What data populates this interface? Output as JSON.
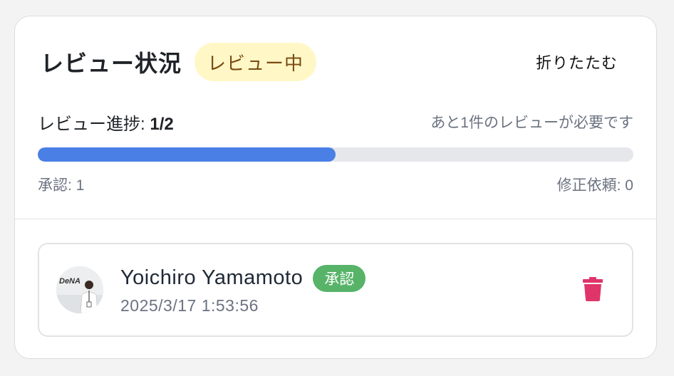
{
  "header": {
    "title": "レビュー状況",
    "status_badge": "レビュー中",
    "collapse_label": "折りたたむ"
  },
  "progress": {
    "label": "レビュー進捗:",
    "value_text": "1/2",
    "remaining_text": "あと1件のレビューが必要です",
    "fraction": 0.5,
    "approved_text": "承認: 1",
    "changes_text": "修正依頼: 0"
  },
  "reviewer": {
    "name": "Yoichiro Yamamoto",
    "status": "承認",
    "date": "2025/3/17 1:53:56",
    "avatar_text": "DeNA"
  },
  "colors": {
    "accent": "#4a7fe5",
    "badge_review_bg": "#fff7c6",
    "badge_approved_bg": "#57b368",
    "delete": "#e0356a"
  },
  "icons": {
    "delete": "trash-icon"
  }
}
